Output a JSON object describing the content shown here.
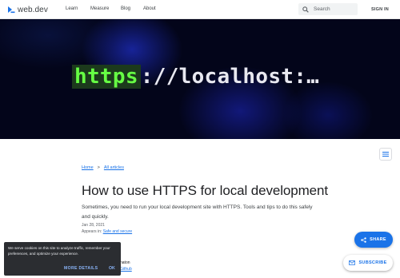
{
  "header": {
    "logo_text": "web.dev",
    "nav": [
      "Learn",
      "Measure",
      "Blog",
      "About"
    ],
    "search_placeholder": "Search",
    "signin_label": "SIGN IN"
  },
  "hero": {
    "code_https": "https",
    "code_rest": "://localhost:…"
  },
  "article": {
    "breadcrumb": [
      "Home",
      "All articles"
    ],
    "breadcrumb_separator": ">",
    "title": "How to use HTTPS for local development",
    "description": "Sometimes, you need to run your local development site with HTTPS. Tools and tips to do this safely and quickly.",
    "date": "Jan 28, 2021",
    "appears_in_label": "Appears in:",
    "appears_in_link": "Safe and secure",
    "author_fragment": "naton",
    "author_link": "Github"
  },
  "cookie_banner": {
    "text": "We serve cookies on this site to analyze traffic, remember your preferences, and optimize your experience.",
    "more_details": "MORE DETAILS",
    "ok": "OK"
  },
  "fab": {
    "share_label": "SHARE",
    "subscribe_label": "SUBSCRIBE"
  },
  "colors": {
    "accent": "#1a73e8",
    "https_green": "#66ff44",
    "hero_bg": "#03051a",
    "cookie_bg": "#2b2d31"
  },
  "icons": [
    "web-dev-logo-icon",
    "search-icon",
    "toc-icon",
    "share-icon",
    "mail-icon"
  ]
}
